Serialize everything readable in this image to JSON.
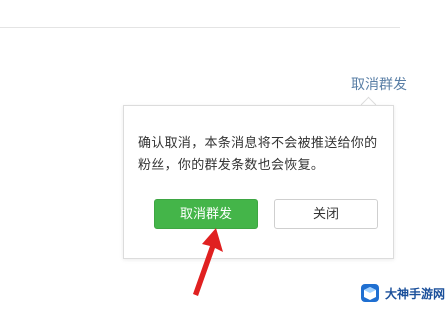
{
  "header": {
    "cancel_mass_send_link": "取消群发"
  },
  "popover": {
    "message": "确认取消，本条消息将不会被推送给你的粉丝，你的群发条数也会恢复。",
    "confirm_button": "取消群发",
    "close_button": "关闭"
  },
  "annotation": {
    "arrow_color": "#e02020"
  },
  "watermark": {
    "text": "大神手游网"
  },
  "colors": {
    "primary_green": "#44b549",
    "link_blue": "#5a7fa6"
  }
}
